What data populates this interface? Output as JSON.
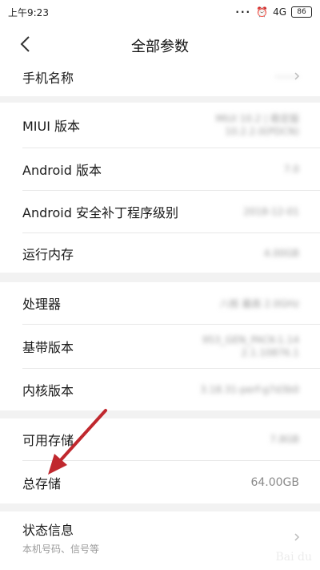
{
  "status": {
    "time": "上午9:23",
    "network": "4G",
    "battery": "86"
  },
  "header": {
    "title": "全部参数"
  },
  "rows": {
    "phone_name": {
      "label": "手机名称",
      "value": "········"
    },
    "miui": {
      "label": "MIUI 版本",
      "value1": "MIUI 10.2 | 稳定版",
      "value2": "10.2.2.0(PDCN)"
    },
    "android": {
      "label": "Android 版本",
      "value": "7.0"
    },
    "patch": {
      "label": "Android 安全补丁程序级别",
      "value": "2018-12-01"
    },
    "ram": {
      "label": "运行内存",
      "value": "4.00GB"
    },
    "cpu": {
      "label": "处理器",
      "value": "八核 最高 2.0GHz"
    },
    "baseband": {
      "label": "基带版本",
      "value1": "953_GEN_PACK-1.14",
      "value2": "2.1.10876.1"
    },
    "kernel": {
      "label": "内核版本",
      "value": "3.18.31-perf-g7d3b0"
    },
    "avail_storage": {
      "label": "可用存储",
      "value": "7.8GB"
    },
    "total_storage": {
      "label": "总存储",
      "value": "64.00GB"
    },
    "status_info": {
      "label": "状态信息",
      "sub": "本机号码、信号等"
    }
  },
  "colors": {
    "annotation_arrow": "#c0282e"
  }
}
